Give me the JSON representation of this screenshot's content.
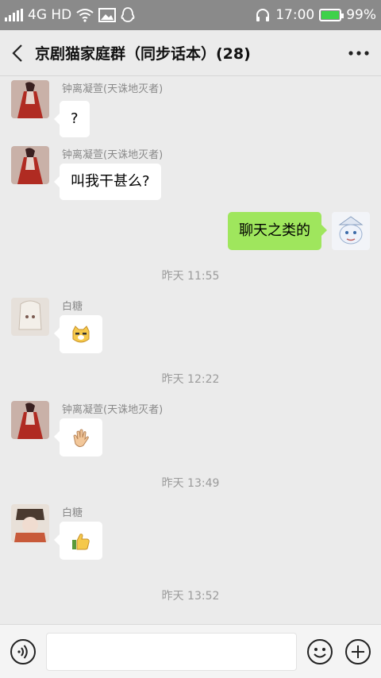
{
  "status_bar": {
    "network": "4G HD",
    "time": "17:00",
    "battery": "99%",
    "battery_level": 0.99
  },
  "header": {
    "title": "京剧猫家庭群（同步话本）(28)"
  },
  "messages": [
    {
      "sender": "钟离凝萱(天诛地灭者)",
      "text": "?"
    },
    {
      "sender": "钟离凝萱(天诛地灭者)",
      "text": "叫我干甚么?"
    },
    {
      "text": "聊天之类的"
    },
    {
      "time": "昨天 11:55"
    },
    {
      "sender": "白糖",
      "emoji": "cat-face-emoji"
    },
    {
      "time": "昨天 12:22"
    },
    {
      "sender": "钟离凝萱(天诛地灭者)",
      "emoji": "waving-hand-emoji"
    },
    {
      "time": "昨天 13:49"
    },
    {
      "sender": "白糖",
      "emoji": "thumbs-up-emoji"
    },
    {
      "time": "昨天 13:52"
    }
  ],
  "colors": {
    "my_bubble": "#9fe65d",
    "other_bubble": "#ffffff",
    "background": "#ebebeb",
    "status_bar": "#8a8a8a"
  },
  "icons": [
    "back-icon",
    "more-icon",
    "voice-icon",
    "emoji-icon",
    "plus-icon"
  ]
}
